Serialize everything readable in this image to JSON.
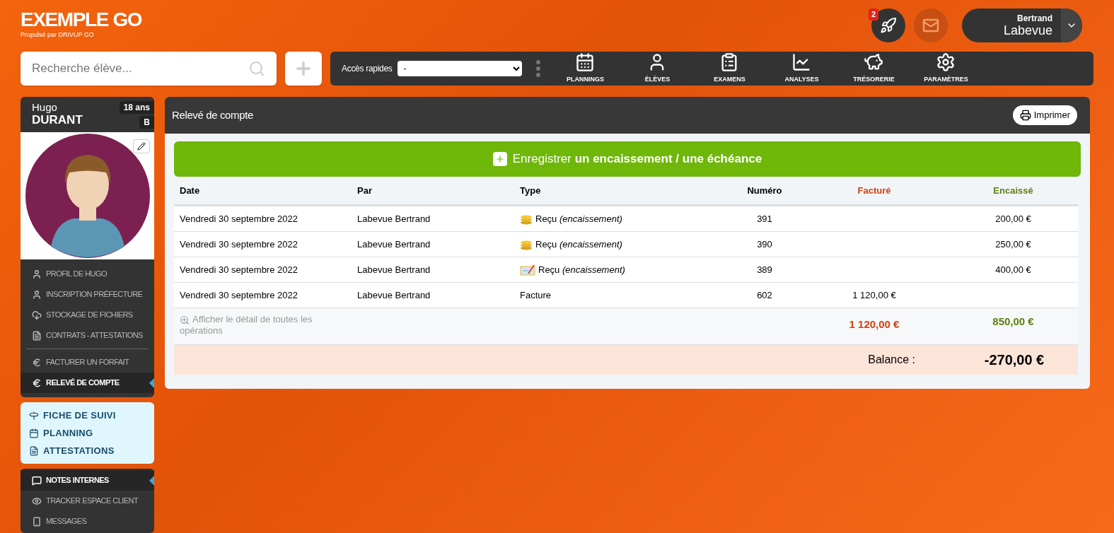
{
  "brand": {
    "title": "EXEMPLE GO",
    "subtitle": "Propulsé par DRIVUP GO"
  },
  "header": {
    "notifications_badge": "2",
    "user": {
      "first_name": "Bertrand",
      "last_name": "Labevue"
    }
  },
  "search": {
    "placeholder": "Recherche élève..."
  },
  "quick_access": {
    "label": "Accès rapides",
    "value": "-"
  },
  "nav": [
    {
      "kind": "calendar",
      "label": "PLANNINGS"
    },
    {
      "kind": "person",
      "label": "ÉLÈVES"
    },
    {
      "kind": "clipboard",
      "label": "EXAMENS"
    },
    {
      "kind": "chart",
      "label": "ANALYSES"
    },
    {
      "kind": "piggy",
      "label": "TRÉSORERIE"
    },
    {
      "kind": "gear",
      "label": "PARAMÈTRES"
    }
  ],
  "student": {
    "first_name": "Hugo",
    "last_name": "DURANT",
    "age": "18 ans",
    "license": "B"
  },
  "menu": [
    {
      "kind": "person",
      "label": "PROFIL DE HUGO",
      "selected": false
    },
    {
      "kind": "person",
      "label": "INSCRIPTION PRÉFECTURE",
      "selected": false
    },
    {
      "kind": "cloud",
      "label": "STOCKAGE DE FICHIERS",
      "selected": false
    },
    {
      "kind": "file",
      "label": "CONTRATS - ATTESTATIONS",
      "selected": false
    },
    {
      "kind": "euro",
      "label": "FACTURER UN FORFAIT",
      "selected": false
    },
    {
      "kind": "euro",
      "label": "RELEVÉ DE COMPTE",
      "selected": true
    }
  ],
  "shortcuts": [
    {
      "kind": "road",
      "label": "FICHE DE SUIVI"
    },
    {
      "kind": "calendar",
      "label": "PLANNING"
    },
    {
      "kind": "file",
      "label": "ATTESTATIONS"
    }
  ],
  "menu2": [
    {
      "kind": "comment",
      "label": "NOTES INTERNES",
      "selected": true
    },
    {
      "kind": "eye",
      "label": "TRACKER ESPACE CLIENT",
      "selected": false
    },
    {
      "kind": "phone",
      "label": "MESSAGES",
      "selected": false
    }
  ],
  "panel": {
    "title": "Relevé de compte",
    "print_button": "Imprimer",
    "add_button": "Enregistrer **un encaissement / une échéance**"
  },
  "table": {
    "columns": [
      "Date",
      "Par",
      "Type",
      "Numéro",
      "Facturé",
      "Encaissé"
    ],
    "rows": [
      {
        "date": "Vendredi 30 septembre 2022",
        "by": "Labevue Bertrand",
        "kind": "coins",
        "type": "Reçu *(encaissement)*",
        "number": "391",
        "billed": "",
        "collected": "200,00 €"
      },
      {
        "date": "Vendredi 30 septembre 2022",
        "by": "Labevue Bertrand",
        "kind": "coins",
        "type": "Reçu *(encaissement)*",
        "number": "390",
        "billed": "",
        "collected": "250,00 €"
      },
      {
        "date": "Vendredi 30 septembre 2022",
        "by": "Labevue Bertrand",
        "kind": "cheque",
        "type": "Reçu *(encaissement)*",
        "number": "389",
        "billed": "",
        "collected": "400,00 €"
      },
      {
        "date": "Vendredi 30 septembre 2022",
        "by": "Labevue Bertrand",
        "kind": "plain",
        "type": "Facture",
        "number": "602",
        "billed": "1 120,00 €",
        "collected": ""
      }
    ],
    "detail_link": "Afficher le détail de toutes les opérations",
    "total_billed": "1 120,00 €",
    "total_collected": "850,00 €",
    "balance_label": "Balance :",
    "balance": "-270,00 €"
  }
}
